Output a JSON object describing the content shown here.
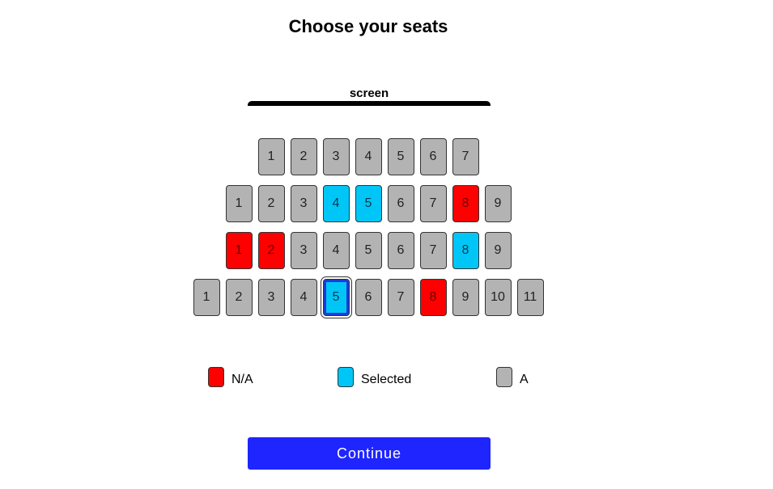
{
  "title": "Choose your seats",
  "screen_label": "screen",
  "colors": {
    "not_available": "#ff0000",
    "selected": "#00c6f7",
    "available": "#b3b3b3",
    "continue_button": "#1f25ff"
  },
  "rows": [
    {
      "seats": [
        {
          "label": "1",
          "status": "available"
        },
        {
          "label": "2",
          "status": "available"
        },
        {
          "label": "3",
          "status": "available"
        },
        {
          "label": "4",
          "status": "available"
        },
        {
          "label": "5",
          "status": "available"
        },
        {
          "label": "6",
          "status": "available"
        },
        {
          "label": "7",
          "status": "available"
        }
      ]
    },
    {
      "seats": [
        {
          "label": "1",
          "status": "available"
        },
        {
          "label": "2",
          "status": "available"
        },
        {
          "label": "3",
          "status": "available"
        },
        {
          "label": "4",
          "status": "selected"
        },
        {
          "label": "5",
          "status": "selected"
        },
        {
          "label": "6",
          "status": "available"
        },
        {
          "label": "7",
          "status": "available"
        },
        {
          "label": "8",
          "status": "not_available"
        },
        {
          "label": "9",
          "status": "available"
        }
      ]
    },
    {
      "seats": [
        {
          "label": "1",
          "status": "not_available"
        },
        {
          "label": "2",
          "status": "not_available"
        },
        {
          "label": "3",
          "status": "available"
        },
        {
          "label": "4",
          "status": "available"
        },
        {
          "label": "5",
          "status": "available"
        },
        {
          "label": "6",
          "status": "available"
        },
        {
          "label": "7",
          "status": "available"
        },
        {
          "label": "8",
          "status": "selected"
        },
        {
          "label": "9",
          "status": "available"
        }
      ]
    },
    {
      "seats": [
        {
          "label": "1",
          "status": "available"
        },
        {
          "label": "2",
          "status": "available"
        },
        {
          "label": "3",
          "status": "available"
        },
        {
          "label": "4",
          "status": "available"
        },
        {
          "label": "5",
          "status": "selected",
          "focused": true
        },
        {
          "label": "6",
          "status": "available"
        },
        {
          "label": "7",
          "status": "available"
        },
        {
          "label": "8",
          "status": "not_available"
        },
        {
          "label": "9",
          "status": "available"
        },
        {
          "label": "10",
          "status": "available"
        },
        {
          "label": "11",
          "status": "available"
        }
      ]
    }
  ],
  "legend": {
    "not_available": "N/A",
    "selected": "Selected",
    "available": "A"
  },
  "continue_label": "Continue"
}
